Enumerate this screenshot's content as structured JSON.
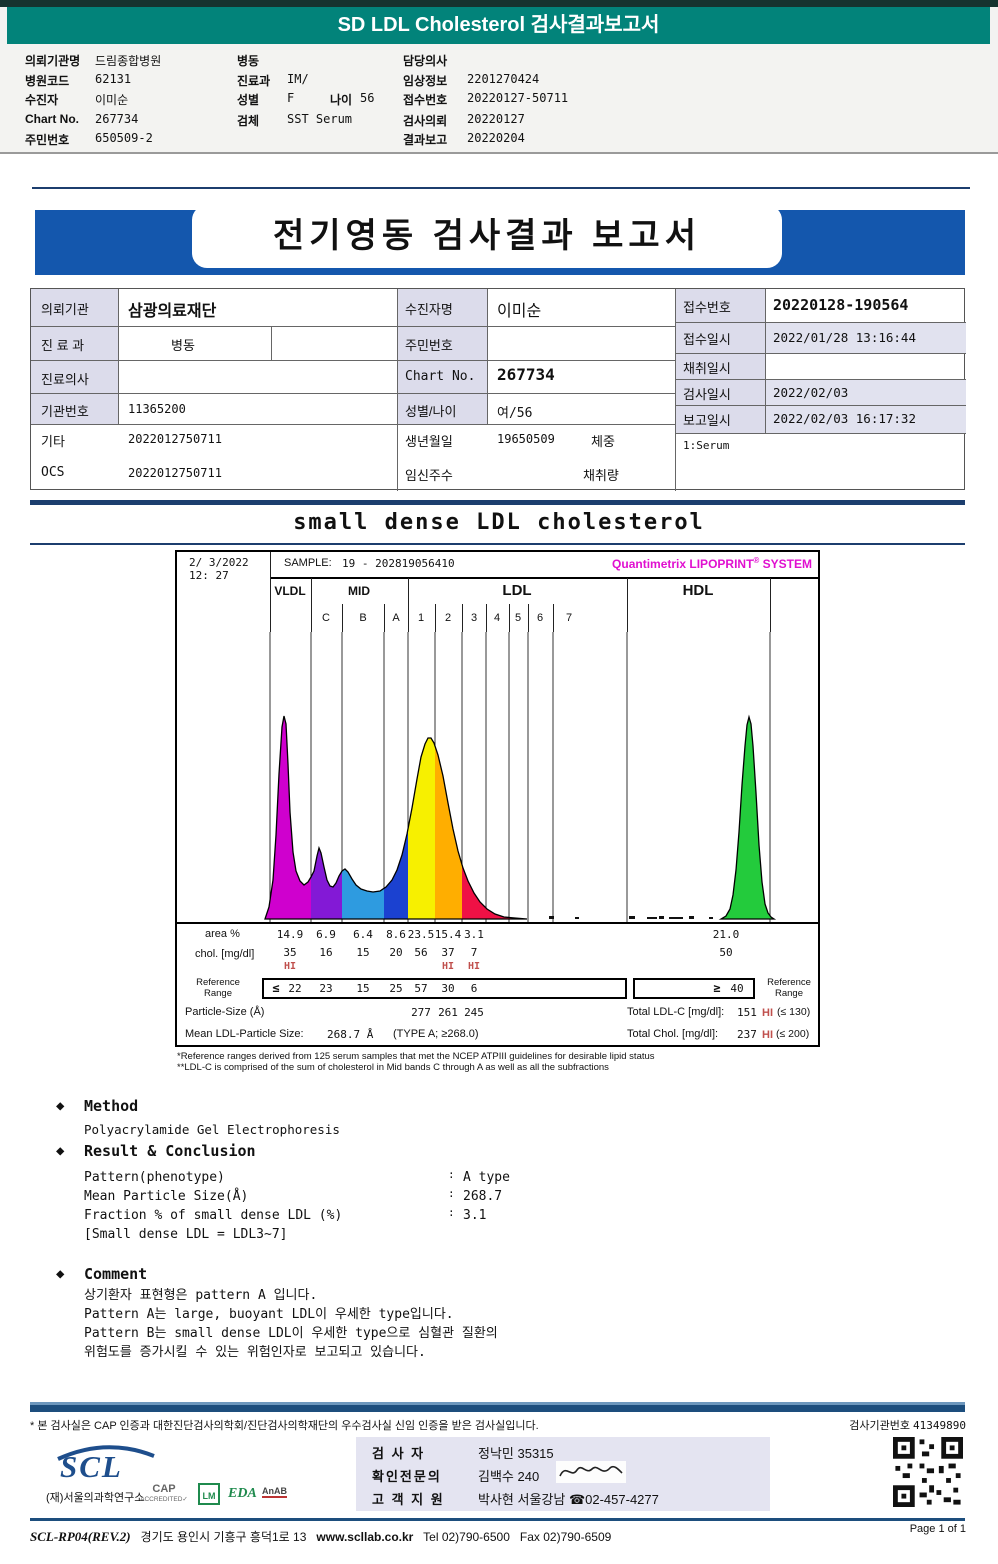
{
  "header": {
    "title": "SD LDL Cholesterol 검사결과보고서",
    "teal_color": "#02837a",
    "col1": [
      {
        "label": "의뢰기관명",
        "value": "드림종합병원"
      },
      {
        "label": "병원코드",
        "value": "62131"
      },
      {
        "label": "수진자",
        "value": "이미순"
      },
      {
        "label": "Chart No.",
        "value": "267734"
      },
      {
        "label": "주민번호",
        "value": "650509-2"
      }
    ],
    "col2": [
      {
        "label": "병동",
        "value": ""
      },
      {
        "label": "진료과",
        "value": "IM/"
      },
      {
        "label": "성별",
        "value": "F",
        "label2": "나이",
        "value2": "56"
      },
      {
        "label": "검체",
        "value": "SST Serum"
      }
    ],
    "col3": [
      {
        "label": "담당의사",
        "value": ""
      },
      {
        "label": "임상정보",
        "value": "2201270424"
      },
      {
        "label": "접수번호",
        "value": "20220127-50711"
      },
      {
        "label": "검사의뢰",
        "value": "20220127"
      },
      {
        "label": "결과보고",
        "value": "20220204"
      }
    ]
  },
  "banner": {
    "title": "전기영동 검사결과 보고서",
    "blue_color": "#1457ad"
  },
  "info": {
    "a0_label": "의뢰기관",
    "a0_value": "삼광의료재단",
    "a1_label": "진 료 과",
    "a1_sub": "병동",
    "a2_label": "진료의사",
    "a2_value": "",
    "a3_label": "기관번호",
    "a3_value": "11365200",
    "a4_label": "기타",
    "a4_value": "2022012750711",
    "a5_label": "OCS",
    "a5_value": "2022012750711",
    "b0_label": "수진자명",
    "b0_value": "이미순",
    "b1_label": "주민번호",
    "b1_value": "",
    "b2_label": "Chart No.",
    "b2_value": "267734",
    "b3_label": "성별/나이",
    "b3_value": "여/56",
    "b4_label": "생년월일",
    "b4_value": "19650509",
    "b4_extra": "체중",
    "b5_label": "임신주수",
    "b5_value": "",
    "b5_extra": "채취량",
    "c0_label": "접수번호",
    "c0_value": "20220128-190564",
    "c1_label": "접수일시",
    "c1_value": "2022/01/28 13:16:44",
    "c2_label": "채취일시",
    "c2_value": "",
    "c3_label": "검사일시",
    "c3_value": "2022/02/03",
    "c4_label": "보고일시",
    "c4_value": "2022/02/03 16:17:32",
    "serum": "1:Serum"
  },
  "section_title": "small dense LDL cholesterol",
  "lipoprint": {
    "date_line1": "2/ 3/2022",
    "date_line2": "12: 27",
    "sample_label": "SAMPLE:",
    "sample_value": "19 - 202819056410",
    "brand": "Quantimetrix LIPOPRINT",
    "brand_reg": "®",
    "brand_suffix": "SYSTEM",
    "brand_color": "#e010d0",
    "band_vldl": "VLDL",
    "band_mid": "MID",
    "band_ldl": "LDL",
    "band_hdl": "HDL",
    "subs": [
      "C",
      "B",
      "A",
      "1",
      "2",
      "3",
      "4",
      "5",
      "6",
      "7"
    ],
    "colors": [
      "#cf00ce",
      "#8319d6",
      "#2e9be0",
      "#1b41d0",
      "#f7f000",
      "#ffae00",
      "#ef1145",
      "#23cb3c"
    ],
    "area_label": "area %",
    "area": [
      "14.9",
      "6.9",
      "6.4",
      "8.6",
      "23.5",
      "15.4",
      "3.1",
      "21.0"
    ],
    "chol_label": "chol. [mg/dl]",
    "chol": [
      "35",
      "16",
      "15",
      "20",
      "56",
      "37",
      "7",
      "50"
    ],
    "hi": "HI",
    "ref_label": "Reference Range",
    "ref_le": "≤",
    "ref": [
      "22",
      "23",
      "15",
      "25",
      "57",
      "30",
      "6"
    ],
    "ref_ge": "≥",
    "ref_hdl": "40",
    "particle_label": "Particle-Size (Å)",
    "particle": [
      "277",
      "261",
      "245"
    ],
    "total_ldl_label": "Total LDL-C [mg/dl]:",
    "total_ldl_value": "151",
    "total_ldl_ref": "(≤ 130)",
    "mean_label": "Mean LDL-Particle Size:",
    "mean_value": "268.7 Å",
    "mean_type": "(TYPE A; ≥268.0)",
    "total_chol_label": "Total Chol. [mg/dl]:",
    "total_chol_value": "237",
    "total_chol_ref": "(≤ 200)",
    "footnote1": "*Reference ranges derived from 125 serum samples that met the NCEP ATPIII guidelines for desirable lipid status",
    "footnote2": "**LDL-C is comprised of the sum of cholesterol in Mid bands C through A as well as all the subfractions"
  },
  "chart_data": {
    "type": "area",
    "title": "small dense LDL cholesterol",
    "subtitle": "Quantimetrix LIPOPRINT SYSTEM electrophoresis trace",
    "x_bands": [
      "VLDL",
      "MID C",
      "MID B",
      "MID A",
      "LDL 1",
      "LDL 2",
      "LDL 3",
      "LDL 4",
      "LDL 5",
      "LDL 6",
      "LDL 7",
      "HDL"
    ],
    "series": [
      {
        "name": "area %",
        "values": [
          14.9,
          6.9,
          6.4,
          8.6,
          23.5,
          15.4,
          3.1,
          0,
          0,
          0,
          0,
          21.0
        ]
      },
      {
        "name": "chol. [mg/dl]",
        "values": [
          35,
          16,
          15,
          20,
          56,
          37,
          7,
          0,
          0,
          0,
          0,
          50
        ]
      }
    ],
    "high_flags": [
      "VLDL",
      "LDL 2",
      "LDL 3"
    ],
    "reference_upper_limits": {
      "VLDL": 22,
      "MID C": 23,
      "MID B": 15,
      "MID A": 25,
      "LDL 1": 57,
      "LDL 2": 30,
      "LDL 3": 6
    },
    "hdl_reference_lower_limit": 40,
    "particle_size_A": {
      "LDL 1": 277,
      "LDL 2": 261,
      "LDL 3": 245
    },
    "mean_ldl_particle_size_A": 268.7,
    "mean_ldl_type": "TYPE A; ≥268.0",
    "total_ldl_c_mg_dl": 151,
    "total_ldl_c_ref": "≤ 130",
    "total_chol_mg_dl": 237,
    "total_chol_ref": "≤ 200",
    "legend_position": "none",
    "grid": "vertical band separators"
  },
  "method": {
    "bullet": "◆",
    "heading": "Method",
    "body": "Polyacrylamide Gel Electrophoresis",
    "rc_heading": "Result & Conclusion",
    "items": [
      {
        "label": "Pattern(phenotype)",
        "colon": ":",
        "value": "A type"
      },
      {
        "label": "Mean Particle Size(Å)",
        "colon": ":",
        "value": "268.7"
      },
      {
        "label": "Fraction % of small dense LDL (%)",
        "colon": ":",
        "value": "3.1"
      }
    ],
    "note": "[Small dense LDL = LDL3~7]",
    "comment_heading": "Comment",
    "comment_lines": [
      "상기환자 표현형은 pattern A 입니다.",
      "Pattern A는 large, buoyant LDL이 우세한 type입니다.",
      "Pattern B는 small dense LDL이 우세한 type으로 심혈관 질환의",
      "위험도를 증가시킬 수 있는 위험인자로 보고되고 있습니다."
    ]
  },
  "footer": {
    "accreditation": "* 본 검사실은 CAP 인증과 대한진단검사의학회/진단검사의학재단의 우수검사실 신임 인증을 받은 검사실입니다.",
    "org_no_label": "검사기관번호",
    "org_no_value": "41349890",
    "scl": "SCL",
    "scl_sub": "(재)서울의과학연구소",
    "cap_line1": "CAP",
    "cap_line2": "ACCREDITED✓",
    "lm": "LM",
    "eda": "EDA",
    "anab": "AnAB",
    "sig_rows": [
      {
        "label": "검  사  자",
        "value": "정낙민 35315"
      },
      {
        "label": "확인전문의",
        "value": "김백수 240"
      },
      {
        "label": "고 객 지 원",
        "value": "박사현 서울강남 ☎02-457-4277"
      }
    ],
    "doc_code": "SCL-RP04(REV.2)",
    "address": "경기도 용인시 기흥구 흥덕1로 13",
    "website": "www.scllab.co.kr",
    "tel": "Tel 02)790-6500",
    "fax": "Fax 02)790-6509",
    "page": "Page 1 of 1"
  }
}
